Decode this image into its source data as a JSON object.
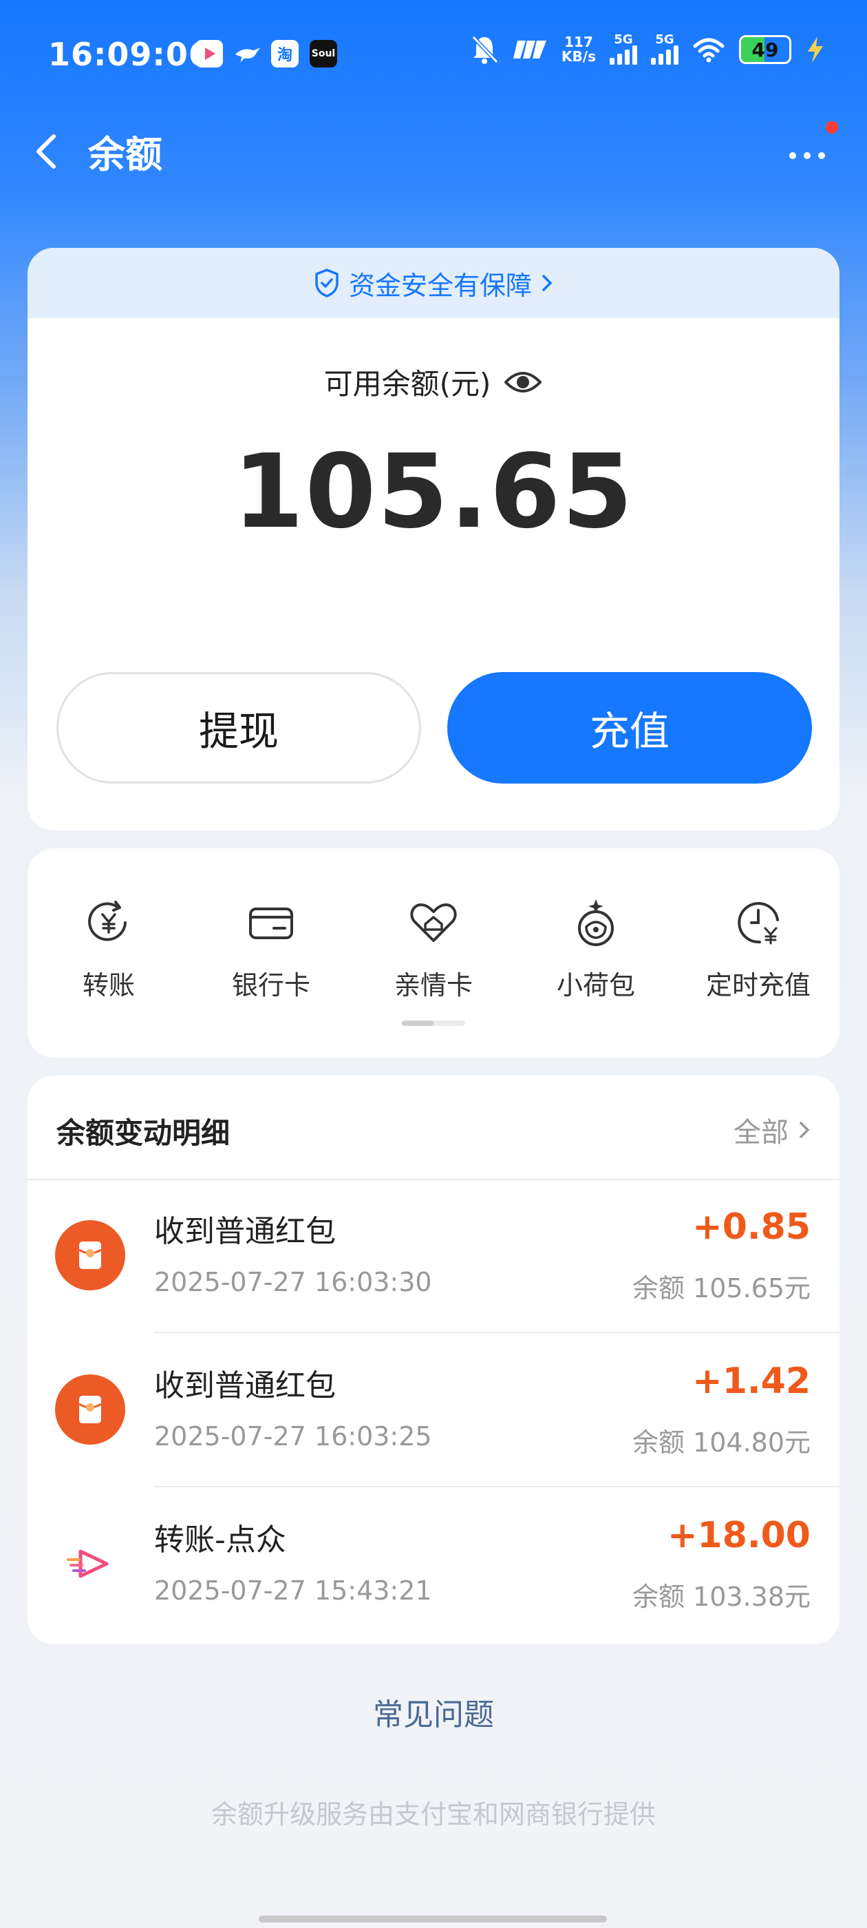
{
  "status_bar": {
    "time": "16:09:06",
    "apps": [
      "点众",
      "鸟",
      "淘",
      "Soul"
    ],
    "speed_value": "117",
    "speed_unit": "KB/s",
    "net1": "5G",
    "net2": "5G",
    "battery": "49",
    "battery_level": 0.49
  },
  "nav": {
    "title": "余额"
  },
  "balance": {
    "secure_text": "资金安全有保障",
    "label": "可用余额(元)",
    "amount": "105.65",
    "withdraw_label": "提现",
    "recharge_label": "充值"
  },
  "quick_actions": [
    {
      "label": "转账",
      "icon": "transfer-yen-icon"
    },
    {
      "label": "银行卡",
      "icon": "bank-card-icon"
    },
    {
      "label": "亲情卡",
      "icon": "family-card-icon"
    },
    {
      "label": "小荷包",
      "icon": "purse-icon"
    },
    {
      "label": "定时充值",
      "icon": "scheduled-recharge-icon"
    }
  ],
  "details": {
    "title": "余额变动明细",
    "all_label": "全部",
    "items": [
      {
        "title": "收到普通红包",
        "time": "2025-07-27 16:03:30",
        "amount": "+0.85",
        "balance": "余额 105.65元",
        "icon": "red-packet-icon"
      },
      {
        "title": "收到普通红包",
        "time": "2025-07-27 16:03:25",
        "amount": "+1.42",
        "balance": "余额 104.80元",
        "icon": "red-packet-icon"
      },
      {
        "title": "转账-点众",
        "time": "2025-07-27 15:43:21",
        "amount": "+18.00",
        "balance": "余额 103.38元",
        "icon": "dianzhong-app-icon"
      }
    ]
  },
  "faq_label": "常见问题",
  "footer_text": "余额升级服务由支付宝和网商银行提供",
  "colors": {
    "primary": "#1677ff",
    "amount_positive": "#ef5a1b",
    "red_packet": "#ec5b25"
  }
}
